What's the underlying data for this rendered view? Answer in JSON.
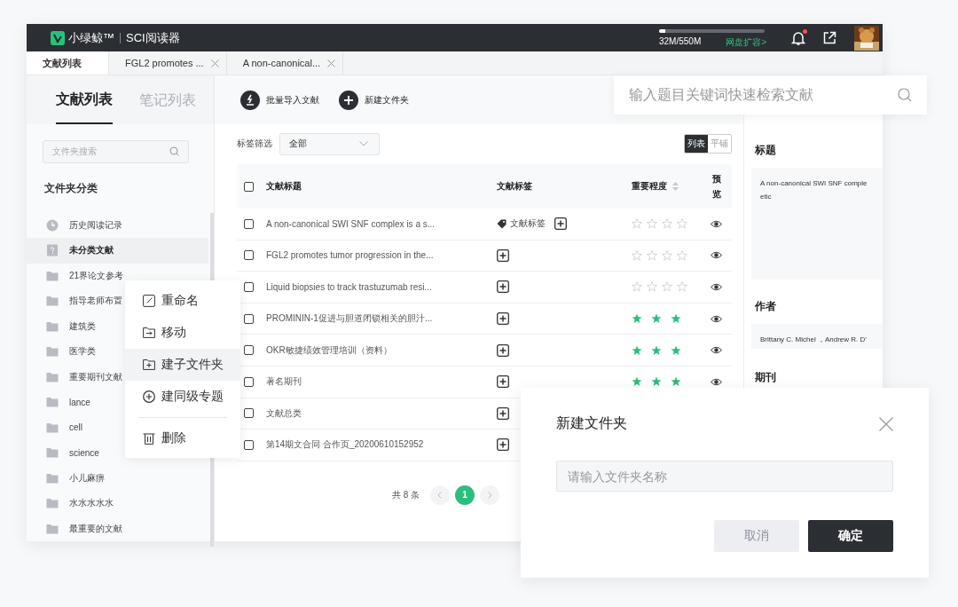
{
  "app_header": {
    "logo_text": "小绿鲸™",
    "product": "SCI阅读器",
    "storage": {
      "level": 0.06,
      "reading": "32M/550M"
    },
    "upgrade_link": "网盘扩容>",
    "notification_dot": true
  },
  "doc_tabs": [
    {
      "label": "文献列表",
      "selected": true,
      "closable": false
    },
    {
      "label": "FGL2 promotes ...",
      "selected": false,
      "closable": true
    },
    {
      "label": "A non-canonical...",
      "selected": false,
      "closable": true
    }
  ],
  "sidebar": {
    "tabs": [
      {
        "label": "文献列表",
        "selected": true
      },
      {
        "label": "笔记列表",
        "selected": false
      }
    ],
    "search": {
      "placeholder": "文件夹搜索"
    },
    "heading": "文件夹分类",
    "items": [
      {
        "kind": "history",
        "label": "历史阅读记录",
        "selected": false
      },
      {
        "kind": "unsorted",
        "label": "未分类文献",
        "selected": true
      },
      {
        "kind": "folder",
        "label": "21界论文参考",
        "selected": false
      },
      {
        "kind": "folder",
        "label": "指导老师布置",
        "selected": false
      },
      {
        "kind": "folder",
        "label": "建筑类",
        "selected": false
      },
      {
        "kind": "folder",
        "label": "医学类",
        "selected": false
      },
      {
        "kind": "folder",
        "label": "重要期刊文献",
        "selected": false
      },
      {
        "kind": "folder",
        "label": "lance",
        "selected": false
      },
      {
        "kind": "folder",
        "label": "cell",
        "selected": false
      },
      {
        "kind": "folder",
        "label": "science",
        "selected": false
      },
      {
        "kind": "folder",
        "label": "小儿麻痹",
        "selected": false
      },
      {
        "kind": "folder",
        "label": "水水水水水",
        "selected": false
      },
      {
        "kind": "folder",
        "label": "最重要的文献",
        "selected": false
      }
    ]
  },
  "toolbar": [
    {
      "kind": "import",
      "label": "批量导入文献"
    },
    {
      "kind": "new-folder",
      "label": "新建文件夹"
    }
  ],
  "filter": {
    "label": "标签筛选",
    "value": "全部"
  },
  "view_toggle": [
    {
      "label": "列表",
      "selected": true
    },
    {
      "label": "平铺",
      "selected": false
    }
  ],
  "table": {
    "header_checked": false,
    "columns": [
      "文献标题",
      "文献标签",
      "重要程度",
      "预览"
    ],
    "rows": [
      {
        "checked": false,
        "title": "A non-canonical SWI SNF complex is a s...",
        "tag": "文献标签",
        "stars": 0,
        "preview": true
      },
      {
        "checked": false,
        "title": "FGL2 promotes tumor progression in the...",
        "stars": 0,
        "preview": true
      },
      {
        "checked": false,
        "title": "Liquid biopsies to track trastuzumab resi...",
        "stars": 0,
        "preview": true
      },
      {
        "checked": false,
        "title": "PROMININ-1促进与胆道闭锁相关的胆汁...",
        "stars": 3,
        "preview": true
      },
      {
        "checked": false,
        "title": "OKR敏捷绩效管理培训（资料）",
        "stars": 3,
        "preview": true
      },
      {
        "checked": false,
        "title": "著名期刊",
        "stars": 3,
        "preview": true
      },
      {
        "checked": false,
        "title": "文献总类",
        "preview": false
      },
      {
        "checked": false,
        "title": "第14期文合同 合作页_20200610152952",
        "preview": false
      }
    ]
  },
  "pagination": {
    "total": "共 8 条",
    "pages": [
      {
        "label": "1",
        "selected": true
      }
    ]
  },
  "detail_panel": {
    "title_label": "标题",
    "title_value": "A non-canonical SWI SNF comple",
    "title_value_2": "etic",
    "author_label": "作者",
    "author_value": "Brittany C. Michel ，Andrew R. D’",
    "journal_label": "期刊"
  },
  "search_overlay": {
    "placeholder": "输入题目关键词快速检索文献"
  },
  "context_menu": [
    {
      "kind": "rename",
      "label": "重命名",
      "selected": false
    },
    {
      "kind": "move",
      "label": "移动",
      "selected": false
    },
    {
      "kind": "subfolder",
      "label": "建子文件夹",
      "selected": true
    },
    {
      "kind": "sibling",
      "label": "建同级专题",
      "selected": false
    },
    {
      "kind": "delete",
      "label": "删除",
      "selected": false
    }
  ],
  "dialog": {
    "title": "新建文件夹",
    "placeholder": "请输入文件夹名称",
    "buttons": [
      {
        "kind": "cancel",
        "label": "取消"
      },
      {
        "kind": "confirm",
        "label": "确定"
      }
    ]
  }
}
